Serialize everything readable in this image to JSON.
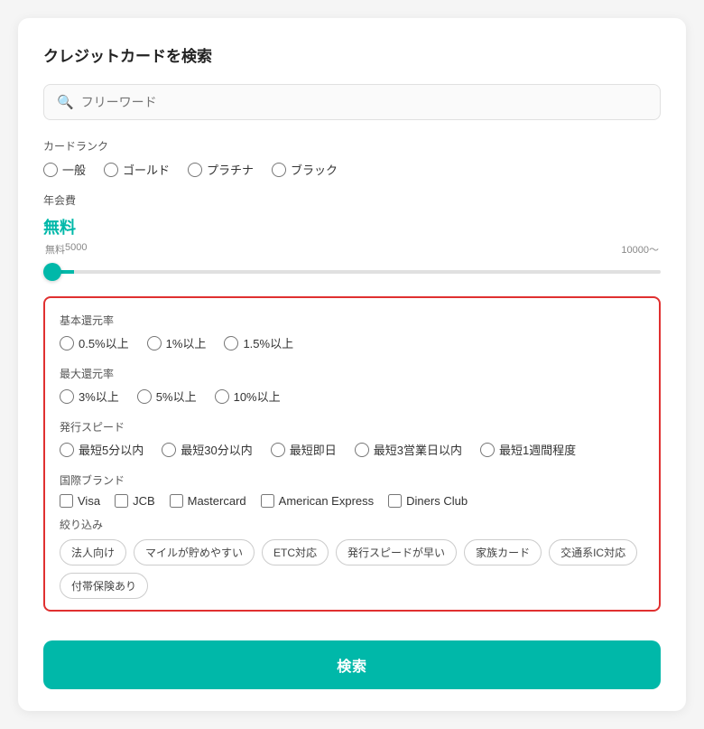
{
  "title": "クレジットカードを検索",
  "search": {
    "placeholder": "フリーワード"
  },
  "card_rank": {
    "label": "カードランク",
    "options": [
      "一般",
      "ゴールド",
      "プラチナ",
      "ブラック"
    ]
  },
  "annual_fee": {
    "label": "年会費",
    "value": "無料",
    "slider_labels": [
      "無料",
      "5000",
      "10000～"
    ]
  },
  "basic_return": {
    "label": "基本還元率",
    "options": [
      "0.5%以上",
      "1%以上",
      "1.5%以上"
    ]
  },
  "max_return": {
    "label": "最大還元率",
    "options": [
      "3%以上",
      "5%以上",
      "10%以上"
    ]
  },
  "issue_speed": {
    "label": "発行スピード",
    "options": [
      "最短5分以内",
      "最短30分以内",
      "最短即日",
      "最短3営業日以内",
      "最短1週間程度"
    ]
  },
  "international_brand": {
    "label": "国際ブランド",
    "options": [
      "Visa",
      "JCB",
      "Mastercard",
      "American Express",
      "Diners Club"
    ]
  },
  "filters": {
    "label": "絞り込み",
    "tags": [
      "法人向け",
      "マイルが貯めやすい",
      "ETC対応",
      "発行スピードが早い",
      "家族カード",
      "交通系IC対応",
      "付帯保険あり"
    ]
  },
  "search_button": {
    "label": "検索"
  }
}
